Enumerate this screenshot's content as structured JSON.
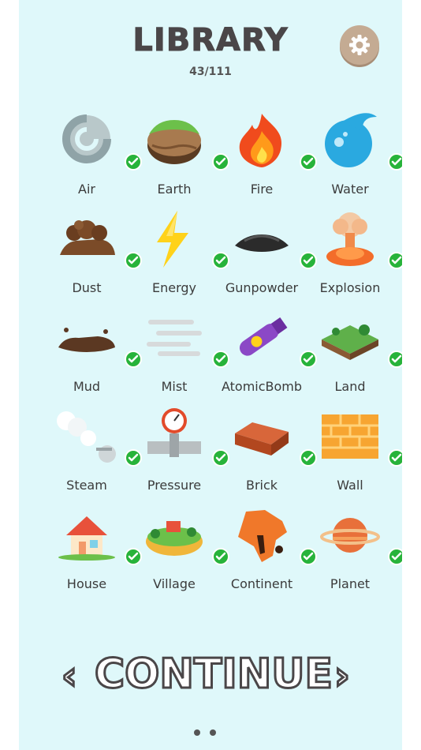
{
  "header": {
    "title": "LIBRARY",
    "count": "43/111"
  },
  "settings": {
    "icon": "gear-icon"
  },
  "items": [
    {
      "label": "Air",
      "icon": "air-icon"
    },
    {
      "label": "Earth",
      "icon": "earth-icon"
    },
    {
      "label": "Fire",
      "icon": "fire-icon"
    },
    {
      "label": "Water",
      "icon": "water-icon"
    },
    {
      "label": "Dust",
      "icon": "dust-icon"
    },
    {
      "label": "Energy",
      "icon": "energy-icon"
    },
    {
      "label": "Gunpowder",
      "icon": "gunpowder-icon"
    },
    {
      "label": "Explosion",
      "icon": "explosion-icon"
    },
    {
      "label": "Mud",
      "icon": "mud-icon"
    },
    {
      "label": "Mist",
      "icon": "mist-icon"
    },
    {
      "label": "AtomicBomb",
      "icon": "atomic-bomb-icon"
    },
    {
      "label": "Land",
      "icon": "land-icon"
    },
    {
      "label": "Steam",
      "icon": "steam-icon"
    },
    {
      "label": "Pressure",
      "icon": "pressure-icon"
    },
    {
      "label": "Brick",
      "icon": "brick-icon"
    },
    {
      "label": "Wall",
      "icon": "wall-icon"
    },
    {
      "label": "House",
      "icon": "house-icon"
    },
    {
      "label": "Village",
      "icon": "village-icon"
    },
    {
      "label": "Continent",
      "icon": "continent-icon"
    },
    {
      "label": "Planet",
      "icon": "planet-icon"
    }
  ],
  "footer": {
    "continue_label": "CONTINUE",
    "prev": "‹",
    "next": "›"
  },
  "colors": {
    "background": "#dff8fa",
    "check": "#27b33a",
    "text": "#4a4648"
  }
}
